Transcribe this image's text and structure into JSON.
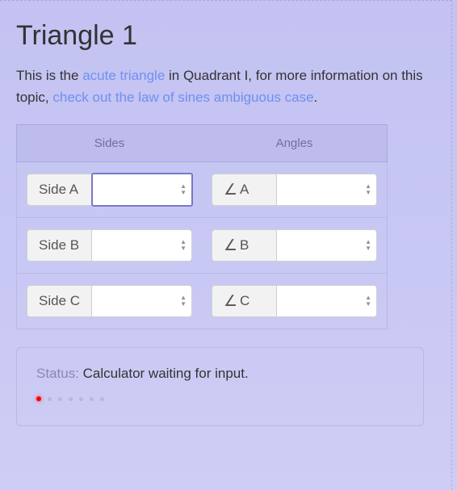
{
  "heading": "Triangle 1",
  "intro": {
    "t1": "This is the ",
    "link1": "acute triangle",
    "t2": " in Quadrant I, for more information on this topic, ",
    "link2": "check out the law of sines ambiguous case",
    "t3": "."
  },
  "columns": {
    "sides": "Sides",
    "angles": "Angles"
  },
  "rows": {
    "a": {
      "side_label": "Side A",
      "side_value": "",
      "angle_letter": "A",
      "angle_value": ""
    },
    "b": {
      "side_label": "Side B",
      "side_value": "",
      "angle_letter": "B",
      "angle_value": ""
    },
    "c": {
      "side_label": "Side C",
      "side_value": "",
      "angle_letter": "C",
      "angle_value": ""
    }
  },
  "status": {
    "label": "Status:",
    "text": "Calculator waiting for input.",
    "active_dot": 0,
    "dot_count": 7
  }
}
